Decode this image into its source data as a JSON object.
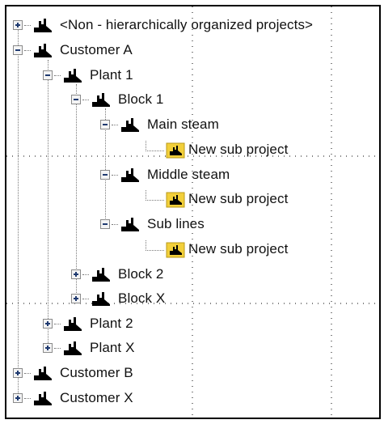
{
  "tree": {
    "root_unassigned": {
      "label": "<Non - hierarchically organized projects>"
    },
    "customer_a": {
      "label": "Customer A",
      "plant_1": {
        "label": "Plant 1",
        "block_1": {
          "label": "Block 1",
          "main_steam": {
            "label": "Main steam",
            "sub": "New sub project"
          },
          "middle_steam": {
            "label": "Middle steam",
            "sub": "New sub project"
          },
          "sub_lines": {
            "label": "Sub lines",
            "sub": "New sub project"
          }
        },
        "block_2": {
          "label": "Block 2"
        },
        "block_x": {
          "label": "Block X"
        }
      },
      "plant_2": {
        "label": "Plant 2"
      },
      "plant_x": {
        "label": "Plant X"
      }
    },
    "customer_b": {
      "label": "Customer B"
    },
    "customer_x": {
      "label": "Customer X"
    }
  },
  "colors": {
    "node_icon": "#000000",
    "sub_project_icon": "#f2cf3a",
    "border": "#000000"
  },
  "icons": {
    "node": "factory-icon",
    "sub_project": "sub-project-folder-icon"
  }
}
